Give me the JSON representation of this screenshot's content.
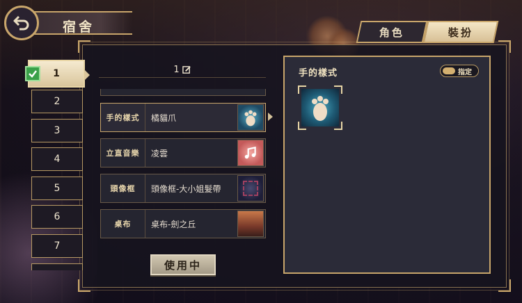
{
  "header": {
    "title": "宿舍"
  },
  "tabs": [
    {
      "label": "角色",
      "active": false
    },
    {
      "label": "裝扮",
      "active": true
    }
  ],
  "slots": [
    "1",
    "2",
    "3",
    "4",
    "5",
    "6",
    "7"
  ],
  "active_slot": "1",
  "preset_name": "1",
  "items": [
    {
      "category": "手的樣式",
      "name": "橘貓爪",
      "selected": true
    },
    {
      "category": "立直音樂",
      "name": "凌雲",
      "selected": false
    },
    {
      "category": "頭像框",
      "name": "頭像框-大小姐髮帶",
      "selected": false
    },
    {
      "category": "桌布",
      "name": "桌布-劍之丘",
      "selected": false
    }
  ],
  "use_button": "使用中",
  "detail_panel": {
    "title": "手的樣式",
    "assign_label": "指定"
  },
  "colors": {
    "accent": "#c9a66b",
    "panel": "#2b2b38",
    "check": "#3aa04a"
  }
}
